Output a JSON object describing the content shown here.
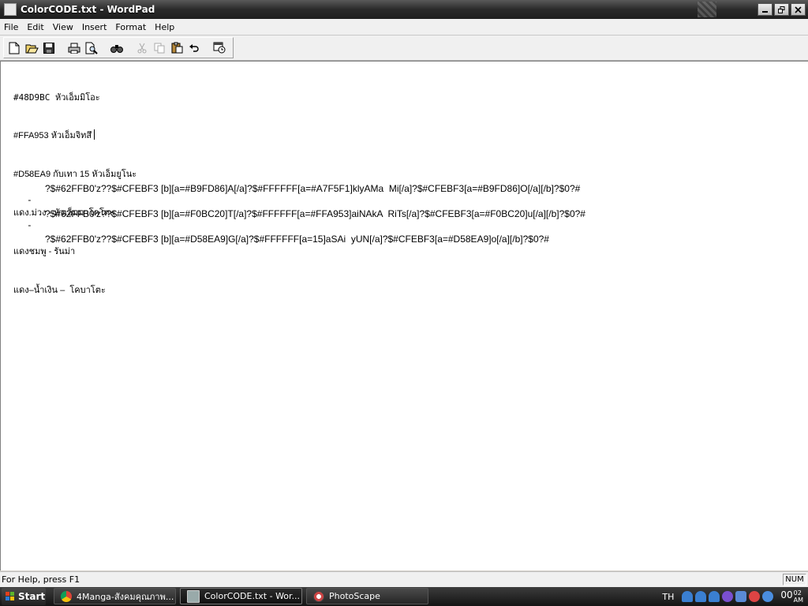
{
  "window": {
    "title": "ColorCODE.txt - WordPad",
    "buttons": [
      "minimize",
      "restore",
      "close"
    ]
  },
  "menu": [
    "File",
    "Edit",
    "View",
    "Insert",
    "Format",
    "Help"
  ],
  "toolbar": {
    "buttons": [
      "new-icon",
      "open-icon",
      "save-icon",
      "print-icon",
      "print-preview-icon",
      "find-icon",
      "cut-icon",
      "copy-icon",
      "paste-icon",
      "undo-icon",
      "date-time-icon"
    ]
  },
  "document": {
    "lines": [
      "#48D9BC หัวเอ็มมิโอะ",
      "#FFA953 หัวเอ็มจิทสึ",
      "#D58EA9 กับเทา 15 หัวเอ็มยูโนะ",
      "แดง.ม่วง - หัวเอ็มมาโคโตะ",
      "แดงชมพู - รันม่า",
      "แดง–น้ำเงิน –  โคบาโตะ"
    ],
    "code_lines": [
      {
        "bullet": "-",
        "text": "?$#62FFB0'z??$#CFEBF3 [b][a=#B9FD86]A[/a]?$#FFFFFF[a=#A7F5F1]klyAMa  Mi[/a]?$#CFEBF3[a=#B9FD86]O[/a][/b]?$0?#"
      },
      {
        "bullet": "-",
        "text": "?$#62FFB0'z??$#CFEBF3 [b][a=#F0BC20]T[/a]?$#FFFFFF[a=#FFA953]aiNAkA  RiTs[/a]?$#CFEBF3[a=#F0BC20]u[/a][/b]?$0?#"
      },
      {
        "bullet": "-",
        "text": "?$#62FFB0'z??$#CFEBF3 [b][a=#D58EA9]G[/a]?$#FFFFFF[a=15]aSAi  yUN[/a]?$#CFEBF3[a=#D58EA9]o[/a][/b]?$0?#"
      }
    ]
  },
  "status": {
    "help": "For Help, press F1",
    "num": "NUM"
  },
  "taskbar": {
    "start": "Start",
    "tasks": [
      "4Manga-สังคมคุณภาพ...",
      "ColorCODE.txt - Wor...",
      "PhotoScape"
    ],
    "lang": "TH",
    "clock": "00",
    "clock_min": "02",
    "clock_ampm": "AM"
  }
}
